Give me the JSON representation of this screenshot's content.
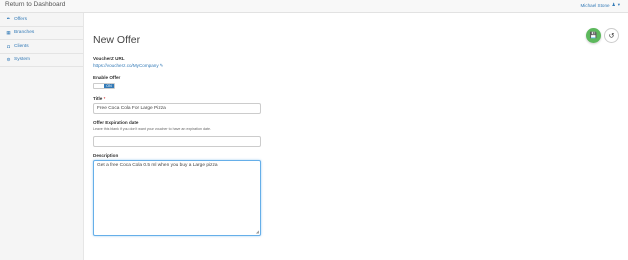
{
  "header": {
    "brand": "Return to Dashboard",
    "user_name": "Michael Stone",
    "user_icon": "user-icon",
    "caret_icon": "caret-down-icon"
  },
  "sidebar": {
    "items": [
      {
        "label": "Offers",
        "icon": "tag-icon",
        "glyph": "✎"
      },
      {
        "label": "Branches",
        "icon": "building-icon",
        "glyph": "▦"
      },
      {
        "label": "Clients",
        "icon": "clients-icon",
        "glyph": "◘"
      },
      {
        "label": "System",
        "icon": "cogs-icon",
        "glyph": "⚙"
      }
    ]
  },
  "page": {
    "title": "New Offer",
    "save_icon": "save-icon",
    "reset_icon": "undo-icon"
  },
  "form": {
    "voucher_url_label": "VoucherZ URL",
    "voucher_url": "https://voucherz.co/MyCompany",
    "enable_label": "Enable Offer",
    "toggle_on_label": "ON",
    "title_label": "Title",
    "required_mark": "*",
    "title_value": "Free Coca Cola For Large Pizza",
    "expiration_label": "Offer Expiration date",
    "expiration_hint": "Leave this blank if you don't want your voucher to have an expiration date.",
    "expiration_value": "",
    "description_label": "Description",
    "description_value": "Get a free Coca Cola 0.5 ml when you buy a Large pizza"
  },
  "colors": {
    "accent": "#337ab7",
    "save_button": "#5cb85c"
  }
}
